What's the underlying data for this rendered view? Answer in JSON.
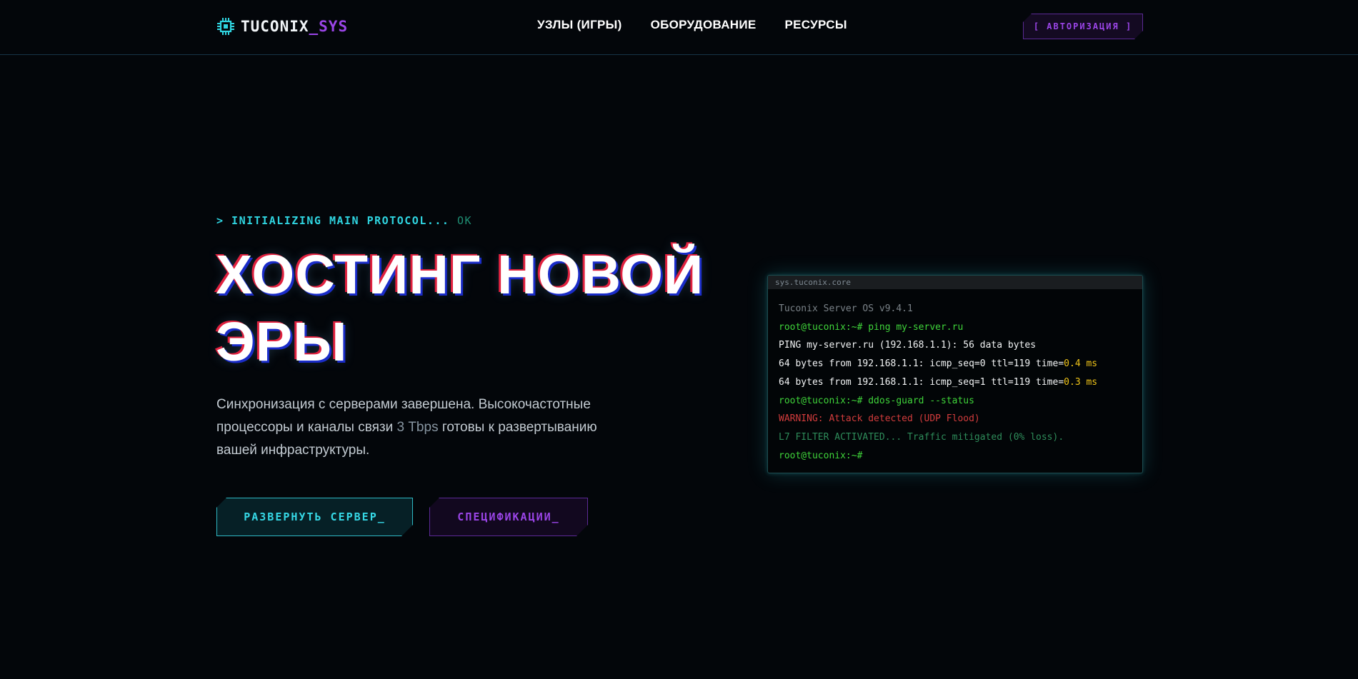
{
  "nav": {
    "brand_main": "TUCONIX",
    "brand_accent": "_SYS",
    "links": [
      "УЗЛЫ (ИГРЫ)",
      "ОБОРУДОВАНИЕ",
      "РЕСУРСЫ"
    ],
    "auth_label": "[ АВТОРИЗАЦИЯ ]"
  },
  "hero": {
    "init_prefix": "> INITIALIZING MAIN PROTOCOL...",
    "init_status": "OK",
    "title_line1": "ХОСТИНГ НОВОЙ",
    "title_line2": "ЭРЫ",
    "desc_part1": "Синхронизация с серверами завершена. Высокочастотные процессоры и каналы связи ",
    "desc_highlight": "3 Tbps",
    "desc_part2": " готовы к развертыванию вашей инфраструктуры.",
    "primary_button": "РАЗВЕРНУТЬ СЕРВЕР_",
    "secondary_button": "СПЕЦИФИКАЦИИ_"
  },
  "terminal": {
    "title": "sys.tuconix.core",
    "lines": {
      "l1": "Tuconix Server OS v9.4.1",
      "l2": "root@tuconix:~# ping my-server.ru",
      "l3": "PING my-server.ru (192.168.1.1): 56 data bytes",
      "l4_text": "64 bytes from 192.168.1.1: icmp_seq=0 ttl=119 time=",
      "l4_time": "0.4 ms",
      "l5_text": "64 bytes from 192.168.1.1: icmp_seq=1 ttl=119 time=",
      "l5_time": "0.3 ms",
      "l6": "root@tuconix:~# ddos-guard --status",
      "l7": "WARNING: Attack detected (UDP Flood)",
      "l8": "L7 FILTER ACTIVATED... Traffic mitigated (0% loss).",
      "l9": "root@tuconix:~#"
    }
  },
  "colors": {
    "accent_cyan": "#2fd4e0",
    "accent_purple": "#9b45e8",
    "background": "#03060a",
    "terminal_green": "#3fd43a",
    "terminal_yellow": "#f0c419",
    "terminal_red": "#d23c3c"
  },
  "icons": {
    "logo": "chip-icon"
  }
}
